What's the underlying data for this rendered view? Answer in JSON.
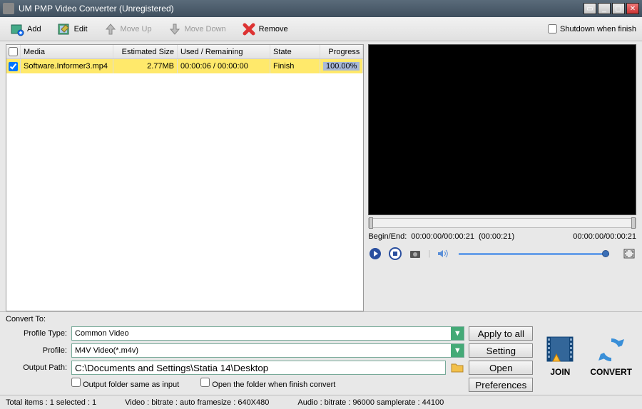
{
  "window": {
    "title": "UM PMP Video Converter  (Unregistered)"
  },
  "toolbar": {
    "add": "Add",
    "edit": "Edit",
    "move_up": "Move Up",
    "move_down": "Move Down",
    "remove": "Remove",
    "shutdown_label": "Shutdown when finish"
  },
  "list": {
    "header": {
      "media": "Media",
      "estimated_size": "Estimated Size",
      "used_remaining": "Used / Remaining",
      "state": "State",
      "progress": "Progress"
    },
    "rows": [
      {
        "media": "Software.Informer3.mp4",
        "size": "2.77MB",
        "used": "00:00:06 / 00:00:00",
        "state": "Finish",
        "progress": "100.00%"
      }
    ]
  },
  "preview": {
    "begin_end_label": "Begin/End:",
    "begin_end_range": "00:00:00/00:00:21",
    "begin_end_duration": "(00:00:21)",
    "position": "00:00:00/00:00:21"
  },
  "convert": {
    "panel_title": "Convert To:",
    "profile_type_label": "Profile Type:",
    "profile_type_value": "Common Video",
    "profile_label": "Profile:",
    "profile_value": "M4V Video(*.m4v)",
    "output_path_label": "Output Path:",
    "output_path_value": "C:\\Documents and Settings\\Statia 14\\Desktop",
    "output_same_as_input": "Output folder same as input",
    "open_when_finish": "Open the folder when finish convert",
    "apply_all": "Apply to all",
    "setting": "Setting",
    "open": "Open",
    "preferences": "Preferences",
    "join": "JOIN",
    "convert_btn": "CONVERT"
  },
  "status": {
    "totals": "Total items : 1  selected : 1",
    "video": "Video :  bitrate :  auto  framesize : 640X480",
    "audio": "Audio :  bitrate :  96000  samplerate : 44100"
  }
}
